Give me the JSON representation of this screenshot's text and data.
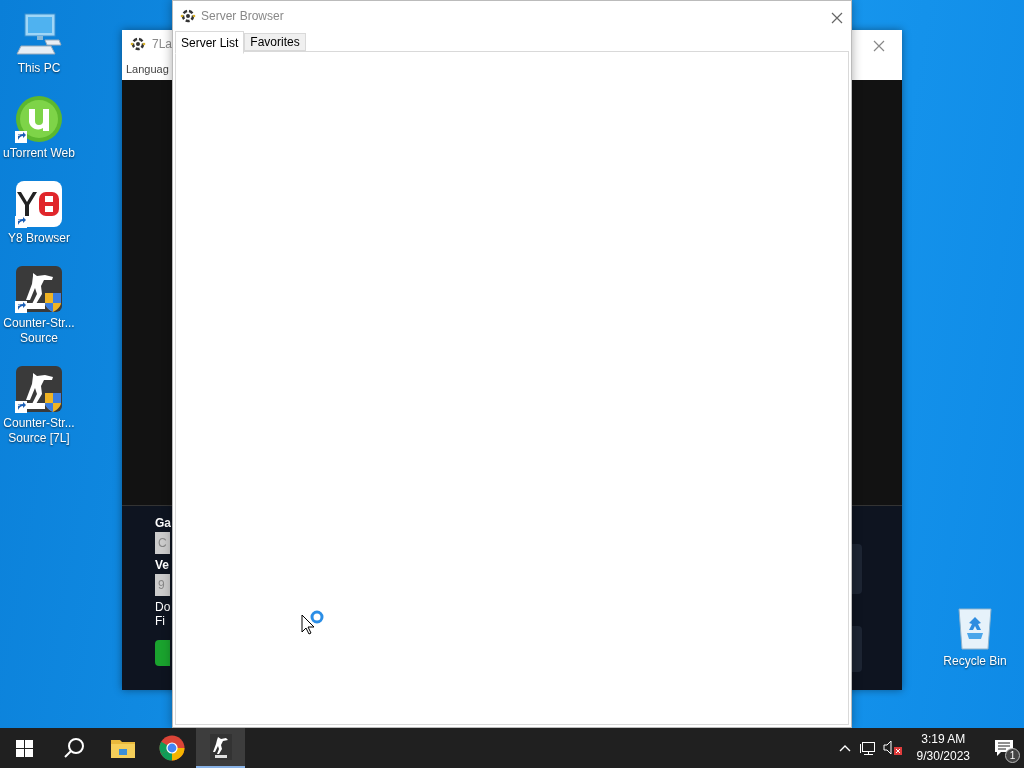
{
  "desktop": {
    "icons": [
      {
        "label": "This PC",
        "kind": "pc",
        "shortcut": false
      },
      {
        "label": "uTorrent Web",
        "kind": "torrent",
        "shortcut": true
      },
      {
        "label": "Y8 Browser",
        "kind": "y8",
        "shortcut": true
      },
      {
        "label": "Counter-Str...\nSource",
        "kind": "css",
        "shortcut": true
      },
      {
        "label": "Counter-Str...\nSource [7L]",
        "kind": "css",
        "shortcut": true
      }
    ],
    "corner_icon": {
      "label": "Recycle Bin",
      "kind": "bin",
      "shortcut": false
    }
  },
  "launcher_window": {
    "title": "7La",
    "menu": [
      "Languag"
    ],
    "fields": [
      {
        "label": "Ga",
        "value": "C"
      },
      {
        "label": "Ve",
        "value": "9"
      }
    ],
    "note_lines": [
      "Do",
      "Fi"
    ]
  },
  "server_browser": {
    "title": "Server Browser",
    "tabs": [
      {
        "label": "Server List",
        "selected": true
      },
      {
        "label": "Favorites",
        "selected": false
      }
    ]
  },
  "taskbar": {
    "apps": [
      {
        "kind": "folder",
        "active": false
      },
      {
        "kind": "chrome",
        "active": false
      },
      {
        "kind": "css",
        "active": true
      }
    ],
    "time": "3:19 AM",
    "date": "9/30/2023",
    "notifications": "1"
  }
}
